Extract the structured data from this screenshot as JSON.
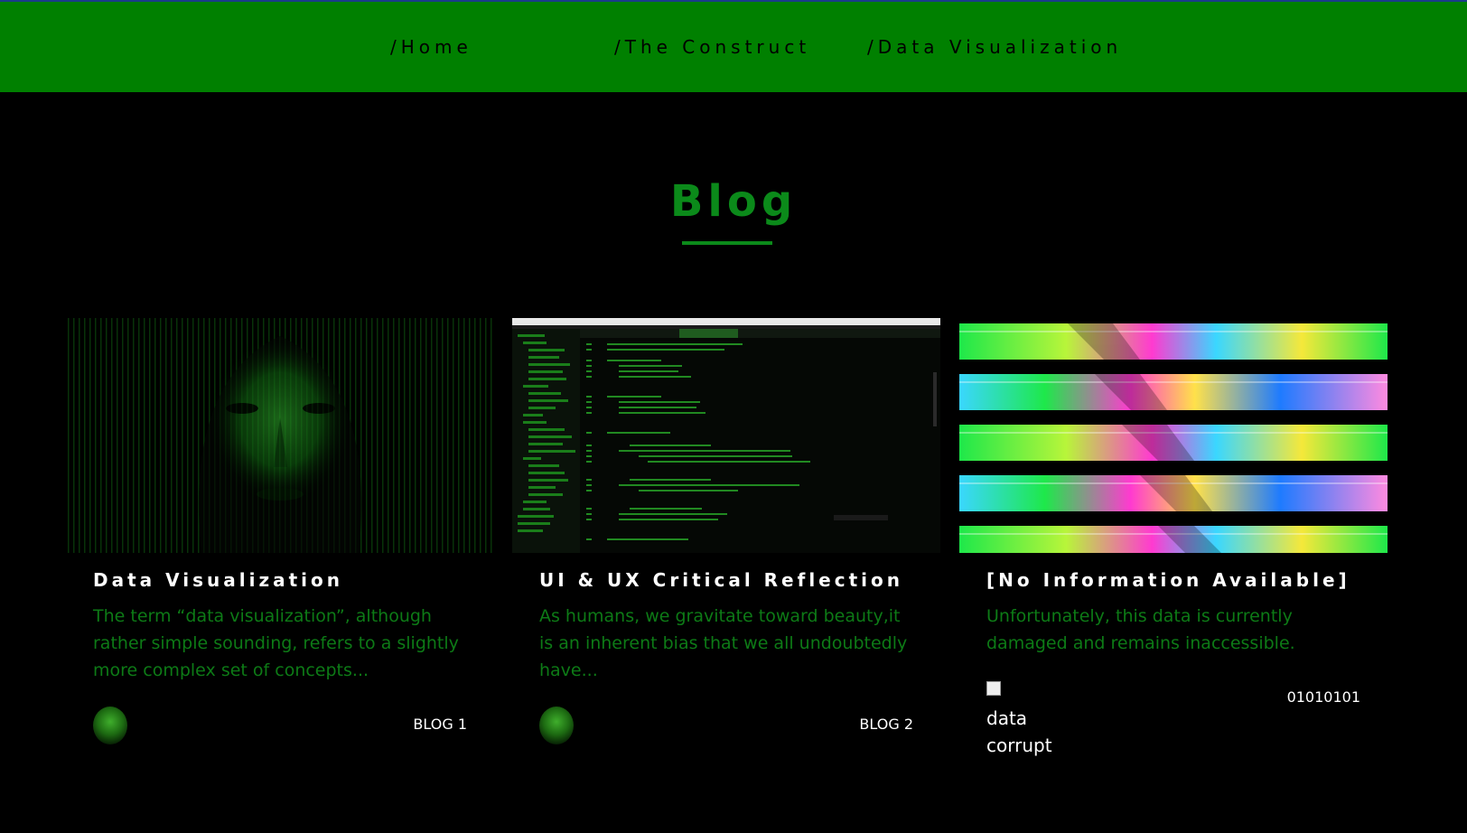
{
  "nav": {
    "items": [
      {
        "label": "/Home"
      },
      {
        "label": "/The Construct"
      },
      {
        "label": "/Data Visualization"
      }
    ]
  },
  "page": {
    "title": "Blog"
  },
  "cards": [
    {
      "title": "Data Visualization",
      "excerpt": "The term “data visualization”, although rather simple sounding, refers to a slightly more complex set of concepts...",
      "tag": "BLOG 1"
    },
    {
      "title": "UI & UX Critical Reflection",
      "excerpt": "As humans, we gravitate toward beauty,it is an inherent bias that we all undoubtedly have...",
      "tag": "BLOG 2"
    },
    {
      "title": "[No Information Available]",
      "excerpt": "Unfortunately, this data is currently damaged and remains inaccessible.",
      "broken_image_alt": "data corrupt",
      "tag": "01010101"
    }
  ],
  "colors": {
    "nav_bg": "#008000",
    "accent_green": "#0b8a1a",
    "excerpt_green": "#0d7a16",
    "background": "#000000"
  }
}
